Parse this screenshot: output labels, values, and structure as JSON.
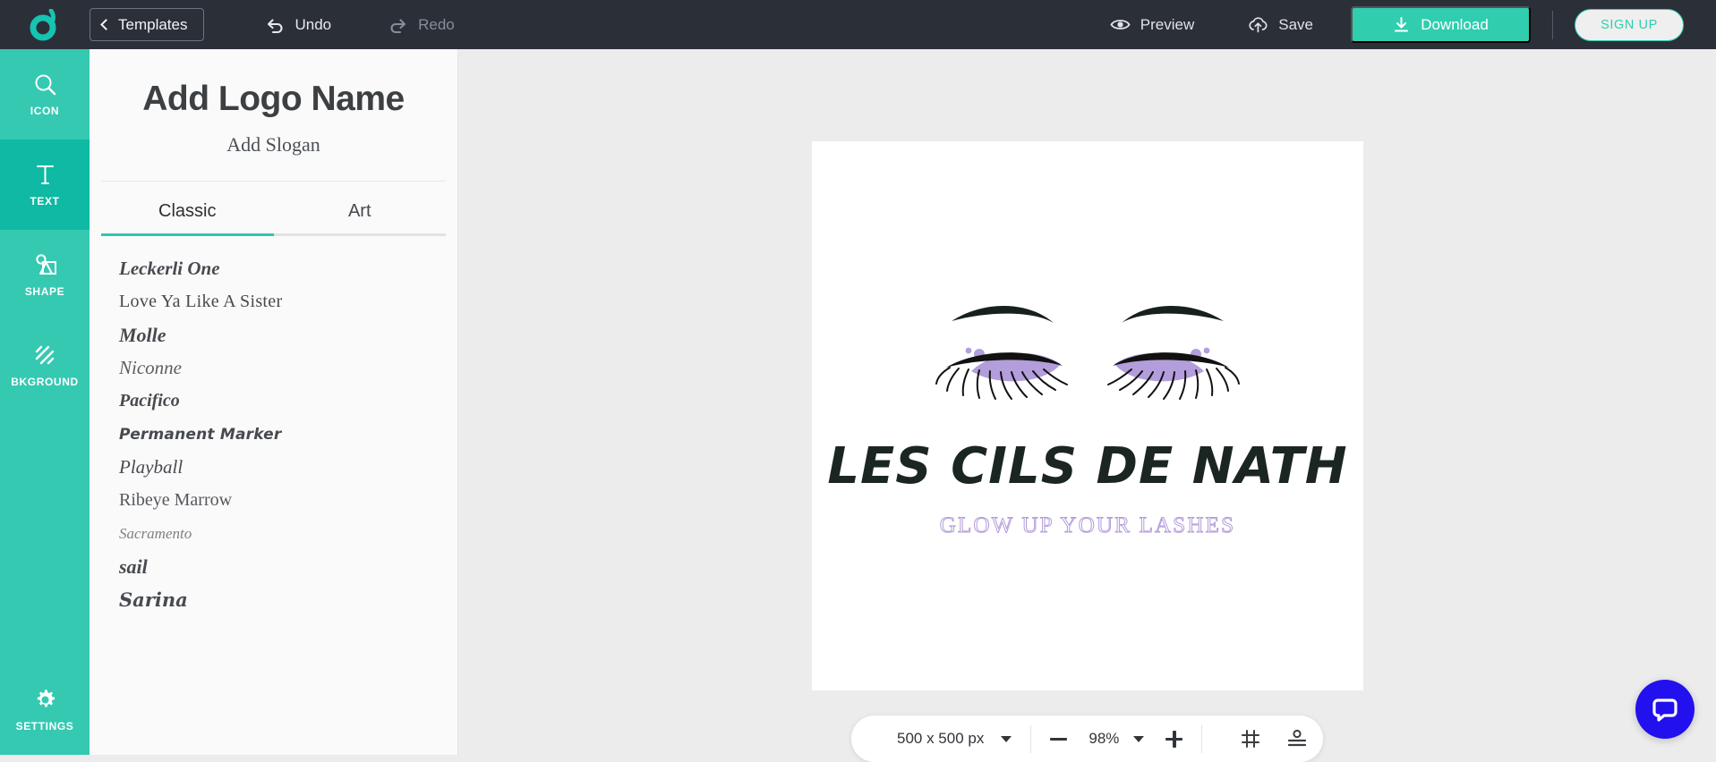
{
  "topbar": {
    "logo_icon": "brand-ring-logo",
    "templates_label": "Templates",
    "back_icon": "chevron-left-icon",
    "undo_label": "Undo",
    "undo_icon": "undo-arrow-icon",
    "redo_label": "Redo",
    "redo_icon": "redo-arrow-icon",
    "preview_label": "Preview",
    "preview_icon": "eye-icon",
    "save_label": "Save",
    "save_icon": "cloud-upload-icon",
    "download_label": "Download",
    "download_icon": "download-icon",
    "signup_label": "SIGN UP",
    "accent_color": "#30cdaf",
    "bar_color": "#2b3038"
  },
  "rail": {
    "accent_color": "#35c9b2",
    "active_color": "#0fb9a3",
    "items": [
      {
        "label": "ICON",
        "icon": "search-icon",
        "active": false
      },
      {
        "label": "TEXT",
        "icon": "text-t-icon",
        "active": true
      },
      {
        "label": "SHAPE",
        "icon": "shapes-icon",
        "active": false
      },
      {
        "label": "BKGROUND",
        "icon": "hatch-square-icon",
        "active": false
      }
    ],
    "settings": {
      "label": "SETTINGS",
      "icon": "gear-icon"
    }
  },
  "panel": {
    "logo_name": "Add Logo Name",
    "logo_slogan": "Add Slogan",
    "tabs": [
      {
        "label": "Classic",
        "active": true
      },
      {
        "label": "Art",
        "active": false
      }
    ],
    "fonts": [
      "Leckerli One",
      "Love Ya Like A Sister",
      "Molle",
      "Niconne",
      "Pacifico",
      "Permanent Marker",
      "Playball",
      "Ribeye Marrow",
      "Sacramento",
      "sail",
      "Sarina"
    ]
  },
  "canvas": {
    "artwork_icon": "closed-eyes-with-lashes-icon",
    "logo_title": "LES CILS DE NATH",
    "logo_tagline": "GLOW UP YOUR LASHES",
    "title_color": "#1b2622",
    "tagline_color": "#b39ddb",
    "eyeshadow_color": "#b39ddb",
    "lash_color": "#111111",
    "background": "#ffffff"
  },
  "zoombar": {
    "size_label": "500 x 500 px",
    "size_caret_icon": "chevron-down-icon",
    "zoom_out_icon": "minus-icon",
    "zoom_level": "98%",
    "zoom_caret_icon": "chevron-down-icon",
    "zoom_in_icon": "plus-icon",
    "grid_icon": "grid-icon",
    "align_icon": "align-center-icon"
  },
  "chat": {
    "icon": "chat-bubble-icon",
    "color": "#2210ee"
  }
}
